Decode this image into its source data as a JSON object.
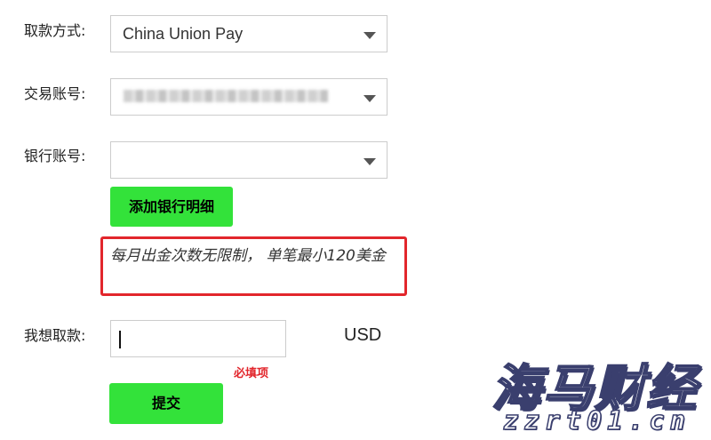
{
  "form": {
    "withdraw_method_label": "取款方式:",
    "withdraw_method_value": "China Union Pay",
    "trading_account_label": "交易账号:",
    "bank_account_label": "银行账号:",
    "bank_account_value": "",
    "add_bank_button": "添加银行明细",
    "notice_text": "每月出金次数无限制， 单笔最小120美金",
    "amount_label": "我想取款:",
    "amount_value": "",
    "currency": "USD",
    "required_hint": "必填项",
    "submit_button": "提交"
  },
  "watermark": {
    "title": "海马财经",
    "url": "zzrt01.cn"
  },
  "colors": {
    "button_green": "#33e23a",
    "notice_border": "#e2262c",
    "required_text": "#e2262c",
    "input_border": "#cccccc"
  }
}
